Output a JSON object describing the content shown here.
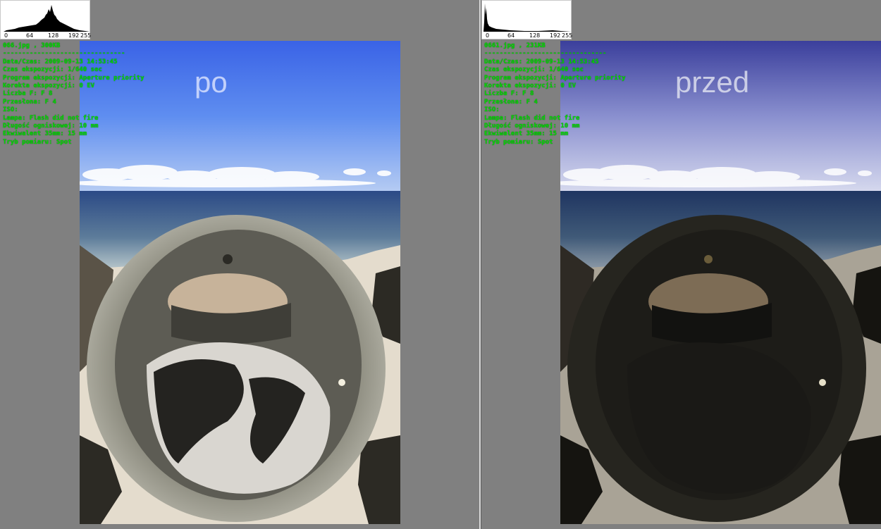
{
  "histogram_ticks": [
    "0",
    "64",
    "128",
    "192",
    "255"
  ],
  "left_pane": {
    "overlay_label": "po",
    "file_info": "066.jpg , 300KB",
    "separator": "--------------------------------",
    "exif": [
      "Data/Czas: 2009-09-13 14:53:45",
      "Czas ekspozycji: 1/640 sec",
      "Program ekspozycji: Aperture priority",
      "Korekta ekspozycji: 0 EV",
      "Liczba F: F 8",
      "Przesłona: F 4",
      "ISO:",
      "Lampa: Flash did not fire",
      "Długość ogniskowej: 10 mm",
      "Ekwiwalent 35mm: 15 mm",
      "Tryb pomiaru: Spot"
    ]
  },
  "right_pane": {
    "overlay_label": "przed",
    "file_info": "0661.jpg , 231KB",
    "separator": "--------------------------------",
    "exif": [
      "Data/Czas: 2009-09-13 14:53:45",
      "Czas ekspozycji: 1/640 sec",
      "Program ekspozycji: Aperture priority",
      "Korekta ekspozycji: 0 EV",
      "Liczba F: F 8",
      "Przesłona: F 4",
      "ISO:",
      "Lampa: Flash did not fire",
      "Długość ogniskowej: 10 mm",
      "Ekwiwalent 35mm: 15 mm",
      "Tryb pomiaru: Spot"
    ]
  },
  "colors": {
    "background": "#808080",
    "exif_text": "#00e000",
    "divider": "#d8d8d8"
  },
  "icons": [
    "histogram-chart",
    "photo-after",
    "photo-before"
  ]
}
